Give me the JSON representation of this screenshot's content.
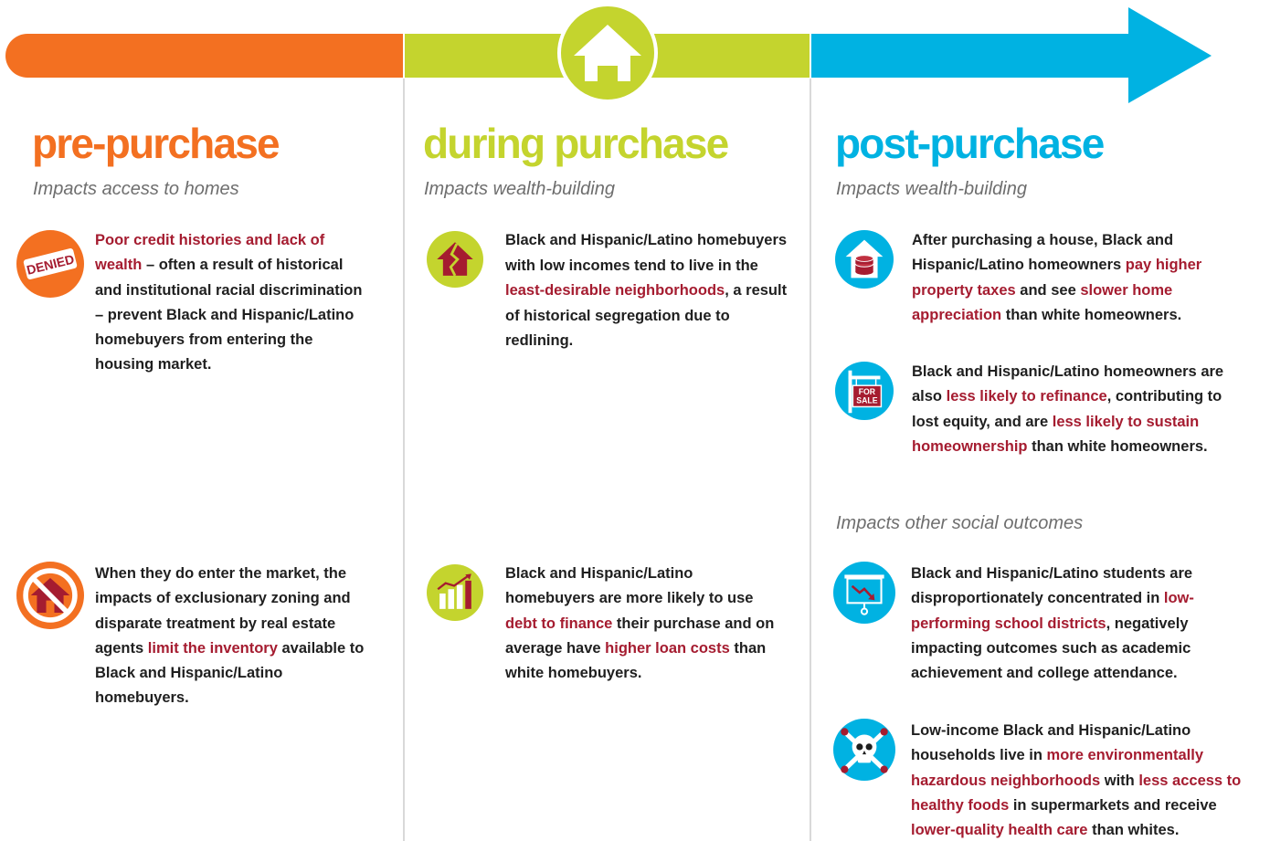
{
  "colors": {
    "orange": "#f37021",
    "green": "#c4d42e",
    "blue": "#00b2e2",
    "highlight": "#a51c30",
    "subtitle": "#6e6e6e",
    "body_text": "#1f1f1f"
  },
  "banner": {
    "center_icon": "house-icon"
  },
  "columns": [
    {
      "title": "pre-purchase",
      "subtitle": "Impacts access to homes",
      "items": [
        {
          "icon": "denied-stamp-icon",
          "denied_label": "DENIED",
          "segments": [
            {
              "t": "Poor credit histories and lack of wealth",
              "h": true
            },
            {
              "t": " – often a result of historical and institutional racial discrimination – prevent Black and Hispanic/Latino homebuyers from entering the housing market.",
              "h": false
            }
          ]
        },
        {
          "icon": "no-house-icon",
          "segments": [
            {
              "t": "When they do enter the market, the impacts of exclusionary zoning and disparate treatment by real estate agents ",
              "h": false
            },
            {
              "t": "limit the inventory",
              "h": true
            },
            {
              "t": " available to Black and Hispanic/Latino homebuyers.",
              "h": false
            }
          ]
        }
      ]
    },
    {
      "title": "during purchase",
      "subtitle": "Impacts wealth-building",
      "items": [
        {
          "icon": "cracked-house-icon",
          "segments": [
            {
              "t": "Black and Hispanic/Latino homebuyers with low incomes tend to live in the ",
              "h": false
            },
            {
              "t": "least-desirable neighborhoods",
              "h": true
            },
            {
              "t": ", a result of historical segregation due to redlining.",
              "h": false
            }
          ]
        },
        {
          "icon": "rising-bar-chart-icon",
          "segments": [
            {
              "t": "Black and Hispanic/Latino homebuyers are more likely to use ",
              "h": false
            },
            {
              "t": "debt to finance",
              "h": true
            },
            {
              "t": " their purchase and on average have ",
              "h": false
            },
            {
              "t": "higher loan costs",
              "h": true
            },
            {
              "t": " than white homebuyers.",
              "h": false
            }
          ]
        }
      ]
    },
    {
      "title": "post-purchase",
      "subtitle": "Impacts wealth-building",
      "subtitle2": "Impacts other social outcomes",
      "items": [
        {
          "icon": "house-coins-icon",
          "segments": [
            {
              "t": "After purchasing a house, Black and Hispanic/Latino homeowners ",
              "h": false
            },
            {
              "t": "pay higher property taxes",
              "h": true
            },
            {
              "t": " and see ",
              "h": false
            },
            {
              "t": "slower home appreciation",
              "h": true
            },
            {
              "t": " than white homeowners.",
              "h": false
            }
          ]
        },
        {
          "icon": "for-sale-sign-icon",
          "sign_line1": "FOR",
          "sign_line2": "SALE",
          "segments": [
            {
              "t": "Black and Hispanic/Latino homeowners are also ",
              "h": false
            },
            {
              "t": "less likely to refinance",
              "h": true
            },
            {
              "t": ", contributing to lost equity, and are ",
              "h": false
            },
            {
              "t": "less likely to sustain homeownership",
              "h": true
            },
            {
              "t": " than white homeowners.",
              "h": false
            }
          ]
        },
        {
          "icon": "declining-chart-board-icon",
          "segments": [
            {
              "t": "Black and Hispanic/Latino students are disproportionately concentrated in ",
              "h": false
            },
            {
              "t": "low-performing school districts",
              "h": true
            },
            {
              "t": ", negatively impacting outcomes such as academic achievement and college attendance.",
              "h": false
            }
          ]
        },
        {
          "icon": "skull-crossbones-icon",
          "segments": [
            {
              "t": "Low-income Black and Hispanic/Latino households live in ",
              "h": false
            },
            {
              "t": "more environmentally hazardous neighborhoods",
              "h": true
            },
            {
              "t": " with ",
              "h": false
            },
            {
              "t": "less access to healthy foods",
              "h": true
            },
            {
              "t": " in supermarkets and receive ",
              "h": false
            },
            {
              "t": "lower-quality health care",
              "h": true
            },
            {
              "t": " than whites.",
              "h": false
            }
          ]
        }
      ]
    }
  ]
}
